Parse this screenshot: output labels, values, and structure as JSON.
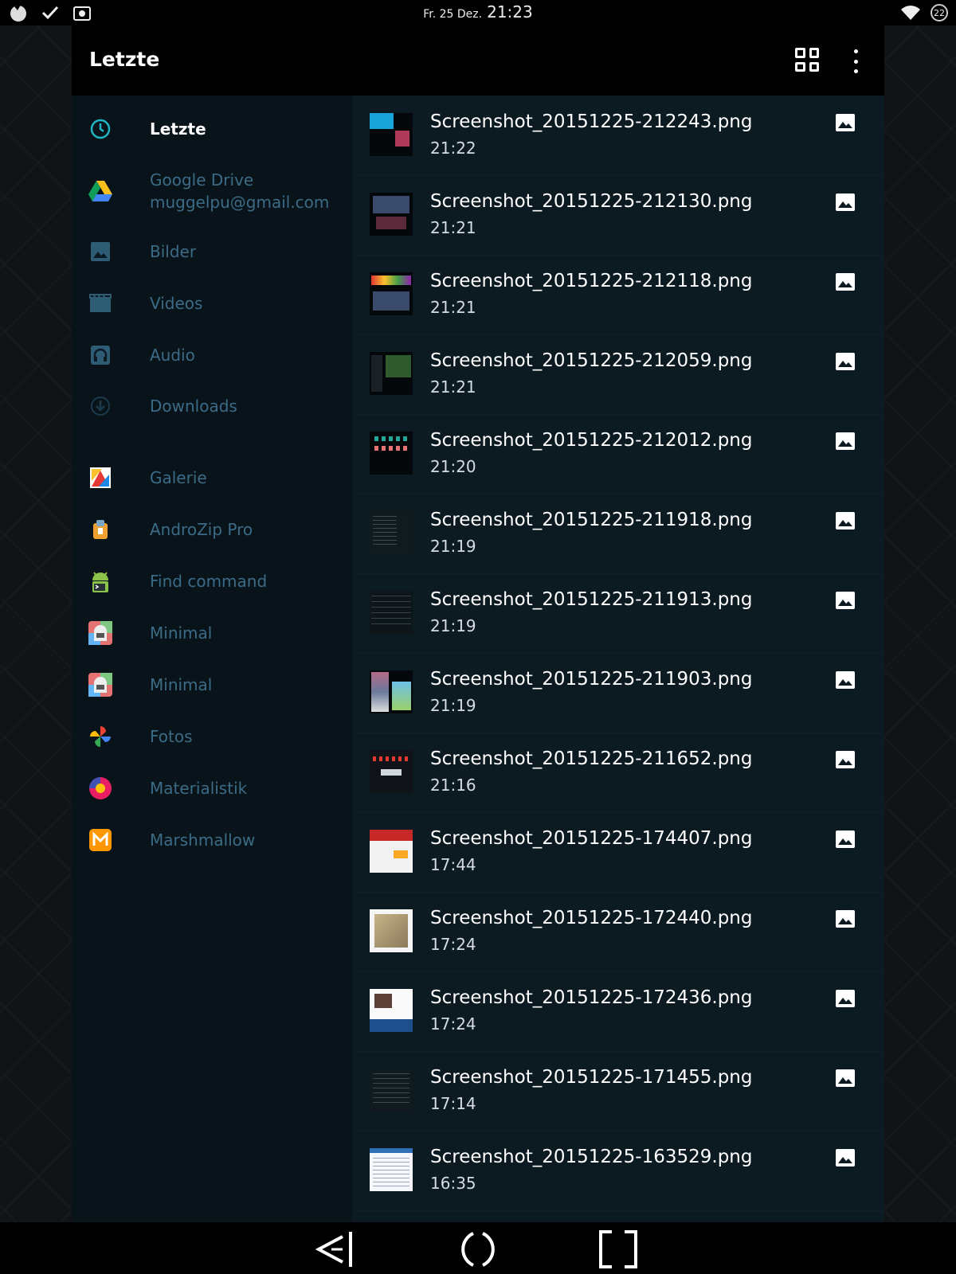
{
  "status_bar": {
    "date": "Fr. 25 Dez.",
    "time": "21:23",
    "badge": "22",
    "icons": [
      "launcher-icon",
      "check-icon",
      "camera-icon",
      "wifi-icon",
      "badge-icon"
    ]
  },
  "app_bar": {
    "title": "Letzte",
    "icons": [
      "grid-view-icon",
      "more-vert-icon"
    ]
  },
  "sidebar": {
    "items": [
      {
        "label": "Letzte",
        "icon": "clock-icon",
        "active": true
      },
      {
        "label": "Google Drive",
        "sub": "muggelpu@gmail.com",
        "icon": "google-drive-icon"
      },
      {
        "label": "Bilder",
        "icon": "image-icon"
      },
      {
        "label": "Videos",
        "icon": "video-icon"
      },
      {
        "label": "Audio",
        "icon": "headphones-icon"
      },
      {
        "label": "Downloads",
        "icon": "download-icon"
      },
      {
        "label": "Galerie",
        "icon": "gallery-icon"
      },
      {
        "label": "AndroZip Pro",
        "icon": "androzip-icon"
      },
      {
        "label": "Find command",
        "icon": "android-terminal-icon"
      },
      {
        "label": "Minimal",
        "icon": "minimal-icon"
      },
      {
        "label": "Minimal",
        "icon": "minimal-icon"
      },
      {
        "label": "Fotos",
        "icon": "photos-icon"
      },
      {
        "label": "Materialistik",
        "icon": "materialistik-icon"
      },
      {
        "label": "Marshmallow",
        "icon": "marshmallow-icon"
      }
    ]
  },
  "files": [
    {
      "name": "Screenshot_20151225-212243.png",
      "time": "21:22"
    },
    {
      "name": "Screenshot_20151225-212130.png",
      "time": "21:21"
    },
    {
      "name": "Screenshot_20151225-212118.png",
      "time": "21:21"
    },
    {
      "name": "Screenshot_20151225-212059.png",
      "time": "21:21"
    },
    {
      "name": "Screenshot_20151225-212012.png",
      "time": "21:20"
    },
    {
      "name": "Screenshot_20151225-211918.png",
      "time": "21:19"
    },
    {
      "name": "Screenshot_20151225-211913.png",
      "time": "21:19"
    },
    {
      "name": "Screenshot_20151225-211903.png",
      "time": "21:19"
    },
    {
      "name": "Screenshot_20151225-211652.png",
      "time": "21:16"
    },
    {
      "name": "Screenshot_20151225-174407.png",
      "time": "17:44"
    },
    {
      "name": "Screenshot_20151225-172440.png",
      "time": "17:24"
    },
    {
      "name": "Screenshot_20151225-172436.png",
      "time": "17:24"
    },
    {
      "name": "Screenshot_20151225-171455.png",
      "time": "17:14"
    },
    {
      "name": "Screenshot_20151225-163529.png",
      "time": "16:35"
    }
  ],
  "nav_bar": {
    "icons": [
      "back-icon",
      "home-icon",
      "recents-icon"
    ]
  },
  "colors": {
    "accent": "#1fb5c4",
    "sidebar_text": "#3b6b86",
    "list_bg": "#0c1a21"
  }
}
